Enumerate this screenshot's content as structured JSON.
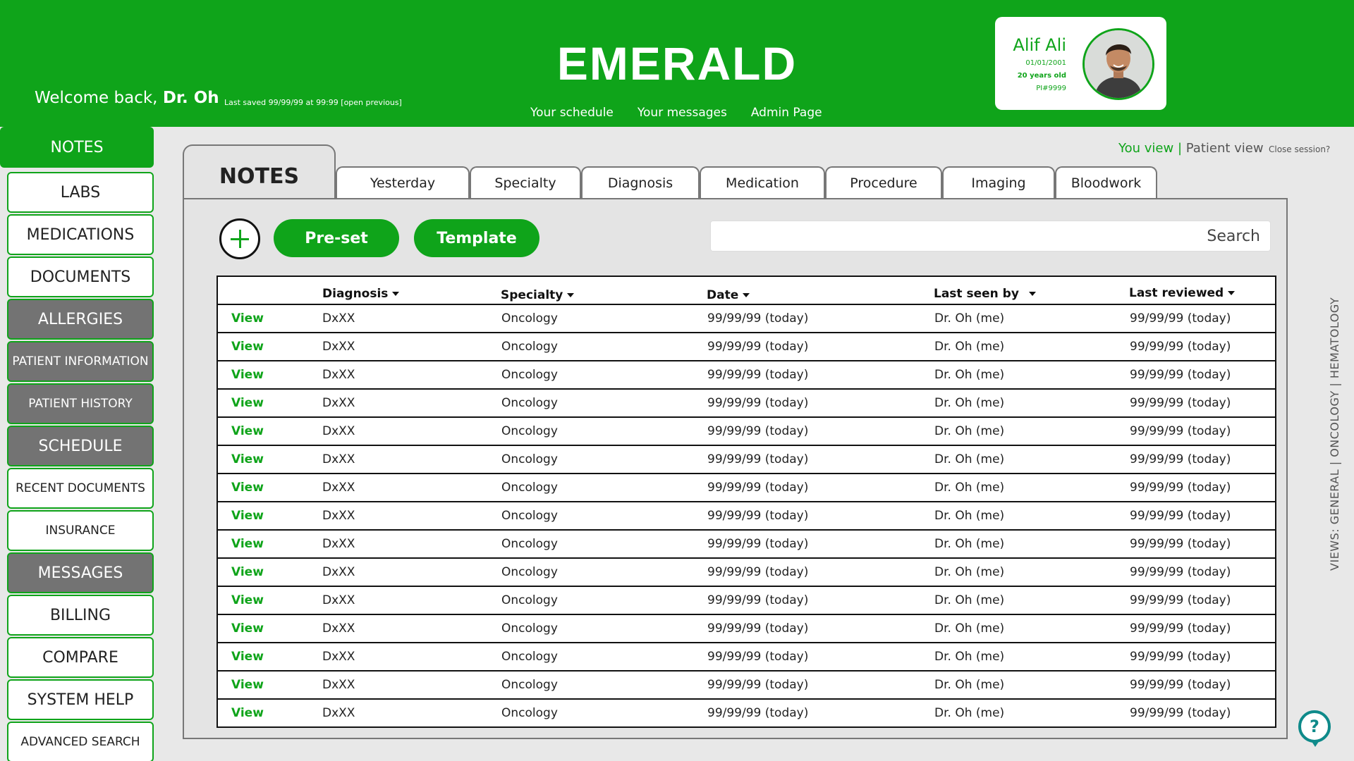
{
  "app": {
    "title": "EMERALD"
  },
  "header": {
    "welcome_prefix": "Welcome back,",
    "welcome_name": "Dr. Oh",
    "last_saved": "Last saved 99/99/99 at 99:99  [open previous]",
    "nav": [
      "Your schedule",
      "Your messages",
      "Admin Page"
    ]
  },
  "patient": {
    "name": "Alif Ali",
    "dob": "01/01/2001",
    "age": "20 years old",
    "id": "PI#9999"
  },
  "sidebar": {
    "items": [
      {
        "label": "NOTES"
      },
      {
        "label": "LABS"
      },
      {
        "label": "MEDICATIONS"
      },
      {
        "label": "DOCUMENTS"
      },
      {
        "label": "ALLERGIES"
      },
      {
        "label": "PATIENT INFORMATION"
      },
      {
        "label": "PATIENT HISTORY"
      },
      {
        "label": "SCHEDULE"
      },
      {
        "label": "RECENT DOCUMENTS"
      },
      {
        "label": "INSURANCE"
      },
      {
        "label": "MESSAGES"
      },
      {
        "label": "BILLING"
      },
      {
        "label": "COMPARE"
      },
      {
        "label": "SYSTEM HELP"
      },
      {
        "label": "ADVANCED SEARCH"
      }
    ]
  },
  "view_toggle": {
    "you_view": "You view",
    "separator": "|",
    "patient_view": "Patient view",
    "close": "Close session?"
  },
  "tabs": {
    "active": "NOTES",
    "items": [
      "Yesterday",
      "Specialty",
      "Diagnosis",
      "Medication",
      "Procedure",
      "Imaging",
      "Bloodwork"
    ]
  },
  "toolbar": {
    "preset_label": "Pre-set",
    "template_label": "Template",
    "search_label": "Search"
  },
  "table": {
    "columns": [
      "Diagnosis",
      "Specialty",
      "Date",
      "Last seen by",
      "Last reviewed"
    ],
    "rows": [
      [
        "View",
        "DxXX",
        "Oncology",
        "99/99/99 (today)",
        "Dr. Oh (me)",
        "99/99/99 (today)"
      ],
      [
        "View",
        "DxXX",
        "Oncology",
        "99/99/99 (today)",
        "Dr. Oh (me)",
        "99/99/99 (today)"
      ],
      [
        "View",
        "DxXX",
        "Oncology",
        "99/99/99 (today)",
        "Dr. Oh (me)",
        "99/99/99 (today)"
      ],
      [
        "View",
        "DxXX",
        "Oncology",
        "99/99/99 (today)",
        "Dr. Oh (me)",
        "99/99/99 (today)"
      ],
      [
        "View",
        "DxXX",
        "Oncology",
        "99/99/99 (today)",
        "Dr. Oh (me)",
        "99/99/99 (today)"
      ],
      [
        "View",
        "DxXX",
        "Oncology",
        "99/99/99 (today)",
        "Dr. Oh (me)",
        "99/99/99 (today)"
      ],
      [
        "View",
        "DxXX",
        "Oncology",
        "99/99/99 (today)",
        "Dr. Oh (me)",
        "99/99/99 (today)"
      ],
      [
        "View",
        "DxXX",
        "Oncology",
        "99/99/99 (today)",
        "Dr. Oh (me)",
        "99/99/99 (today)"
      ],
      [
        "View",
        "DxXX",
        "Oncology",
        "99/99/99 (today)",
        "Dr. Oh (me)",
        "99/99/99 (today)"
      ],
      [
        "View",
        "DxXX",
        "Oncology",
        "99/99/99 (today)",
        "Dr. Oh (me)",
        "99/99/99 (today)"
      ],
      [
        "View",
        "DxXX",
        "Oncology",
        "99/99/99 (today)",
        "Dr. Oh (me)",
        "99/99/99 (today)"
      ],
      [
        "View",
        "DxXX",
        "Oncology",
        "99/99/99 (today)",
        "Dr. Oh (me)",
        "99/99/99 (today)"
      ],
      [
        "View",
        "DxXX",
        "Oncology",
        "99/99/99 (today)",
        "Dr. Oh (me)",
        "99/99/99 (today)"
      ],
      [
        "View",
        "DxXX",
        "Oncology",
        "99/99/99 (today)",
        "Dr. Oh (me)",
        "99/99/99 (today)"
      ],
      [
        "View",
        "DxXX",
        "Oncology",
        "99/99/99 (today)",
        "Dr. Oh (me)",
        "99/99/99 (today)"
      ]
    ]
  },
  "views_label": "VIEWS: GENERAL | ONCOLOGY | HEMATOLOGY",
  "help": {
    "icon": "help-icon",
    "glyph": "?"
  },
  "colors": {
    "brand": "#0fa41a",
    "gray_item": "#737373",
    "help": "#0e8a8a"
  }
}
